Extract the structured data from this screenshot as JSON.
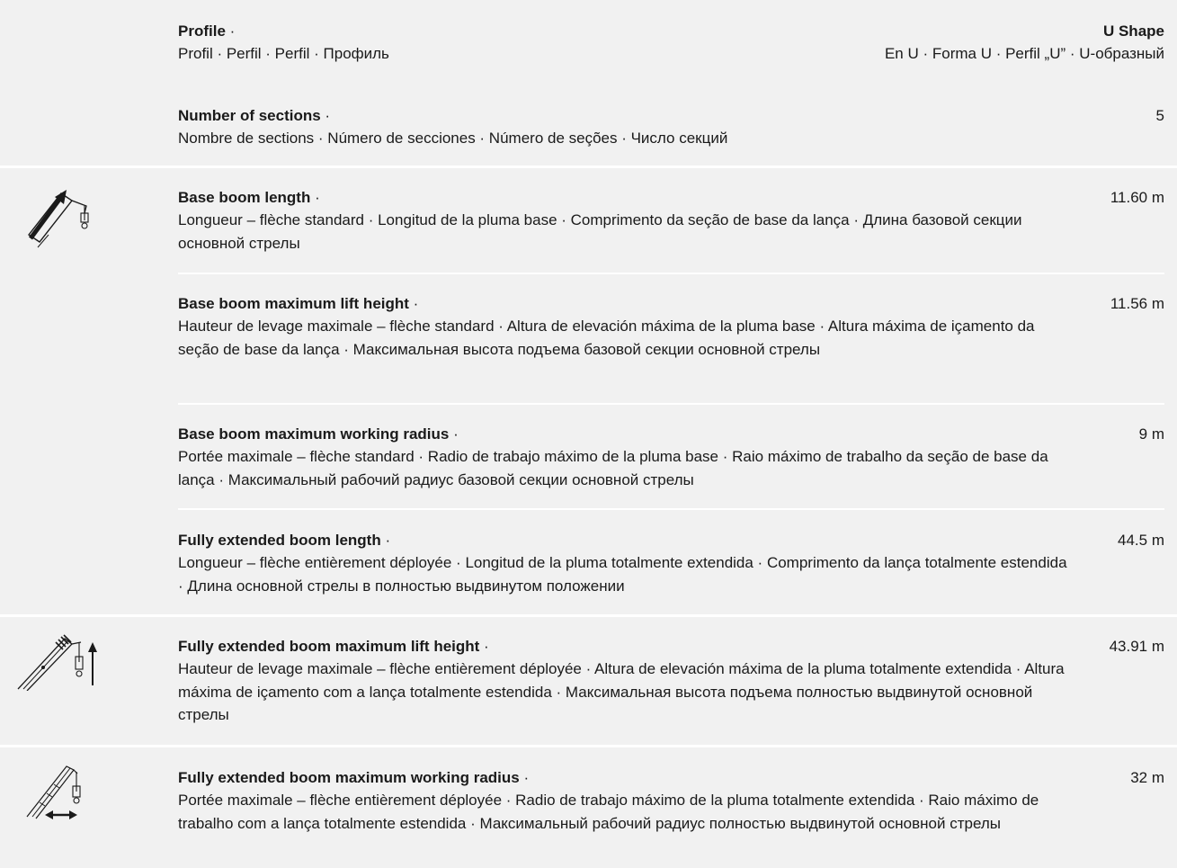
{
  "rows": {
    "profile": {
      "label": "Profile",
      "dot": " ·",
      "translation": "Profil · Perfil · Perfil · Профиль",
      "value": "U Shape",
      "value_translation": "En U · Forma U · Perfil „U” · U-образный"
    },
    "sections": {
      "label": "Number of sections",
      "dot": " ·",
      "translation": "Nombre de sections · Número de secciones · Número de seções · Число секций",
      "value": "5"
    },
    "base_length": {
      "label": "Base boom length",
      "dot": " ·",
      "translation": "Longueur – flèche standard · Longitud de la pluma base · Comprimento da seção de base da lança · Длина базовой секции основной стрелы",
      "value": "11.60 m"
    },
    "base_height": {
      "label": "Base boom maximum lift height",
      "dot": " ·",
      "translation": "Hauteur de levage maximale – flèche standard · Altura de elevación máxima de la pluma base · Altura máxima de içamento da seção de base da lança · Максимальная высота подъема базовой секции основной стрелы",
      "value": "11.56 m"
    },
    "base_radius": {
      "label": "Base boom maximum working radius",
      "dot": " ·",
      "translation": "Portée maximale – flèche standard · Radio de trabajo máximo de la pluma base · Raio máximo de trabalho da seção de base da lança · Максимальный рабочий радиус базовой секции основной стрелы",
      "value": "9 m"
    },
    "full_length": {
      "label": "Fully extended boom length",
      "dot": " ·",
      "translation": "Longueur – flèche entièrement déployée · Longitud de la pluma totalmente extendida · Comprimento da lança totalmente estendida · Длина основной стрелы в полностью выдвинутом положении",
      "value": "44.5 m"
    },
    "full_height": {
      "label": "Fully extended boom maximum lift height",
      "dot": " ·",
      "translation": "Hauteur de levage maximale – flèche entièrement déployée · Altura de elevación máxima de la pluma totalmente extendida · Altura máxima de içamento com a lança totalmente estendida · Максимальная высота подъема полностью выдвинутой основной стрелы",
      "value": "43.91 m"
    },
    "full_radius": {
      "label": "Fully extended boom maximum working radius",
      "dot": " ·",
      "translation": "Portée maximale – flèche entièrement déployée · Radio de trabajo máximo de la pluma totalmente extendida · Raio máximo de trabalho com a lança totalmente estendida · Максимальный рабочий радиус полностью выдвинутой основной стрелы",
      "value": "32 m"
    }
  },
  "icons": {
    "base_boom": "boom-length-icon",
    "lift_height": "boom-lift-height-icon",
    "working_radius": "boom-working-radius-icon"
  }
}
